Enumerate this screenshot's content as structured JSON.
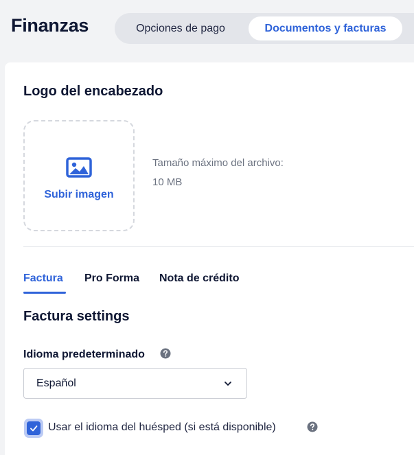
{
  "header": {
    "title": "Finanzas",
    "tabs": [
      {
        "label": "Opciones de pago",
        "active": false
      },
      {
        "label": "Documentos y facturas",
        "active": true
      }
    ]
  },
  "logo": {
    "title": "Logo del encabezado",
    "upload_label": "Subir imagen",
    "upload_icon": "image-icon",
    "max_size_label": "Tamaño máximo del archivo:",
    "max_size_value": "10 MB"
  },
  "doc_tabs": [
    {
      "label": "Factura",
      "active": true
    },
    {
      "label": "Pro Forma",
      "active": false
    },
    {
      "label": "Nota de crédito",
      "active": false
    }
  ],
  "settings": {
    "title": "Factura settings",
    "language_label": "Idioma predeterminado",
    "language_value": "Español",
    "guest_language_label": "Usar el idioma del huésped (si está disponible)",
    "guest_language_checked": true
  },
  "colors": {
    "accent": "#2f63d9",
    "text": "#0f1733",
    "background": "#f2f3f5"
  }
}
